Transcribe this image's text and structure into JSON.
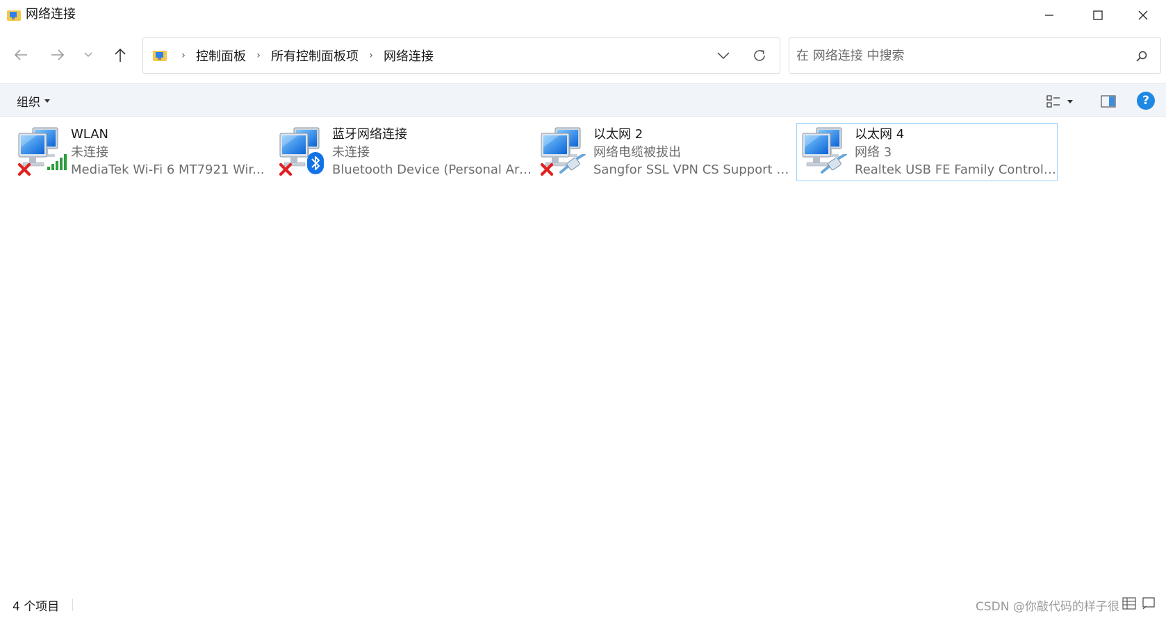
{
  "window": {
    "title": "网络连接",
    "controls": [
      "minimize",
      "maximize",
      "close"
    ]
  },
  "nav": {
    "breadcrumb": [
      "控制面板",
      "所有控制面板项",
      "网络连接"
    ],
    "search_placeholder": "在 网络连接 中搜索"
  },
  "toolbar": {
    "organize_label": "组织",
    "help_label": "?"
  },
  "items": [
    {
      "name": "WLAN",
      "status": "未连接",
      "device": "MediaTek Wi-Fi 6 MT7921 Wir...",
      "icon": "wifi-adapter-icon",
      "disconnected": true
    },
    {
      "name": "蓝牙网络连接",
      "status": "未连接",
      "device": "Bluetooth Device (Personal Are...",
      "icon": "bluetooth-adapter-icon",
      "disconnected": true
    },
    {
      "name": "以太网 2",
      "status": "网络电缆被拔出",
      "device": "Sangfor SSL VPN CS Support S...",
      "icon": "ethernet-adapter-icon",
      "disconnected": true
    },
    {
      "name": "以太网 4",
      "status": "网络 3",
      "device": "Realtek USB FE Family Controll...",
      "icon": "ethernet-adapter-icon",
      "disconnected": false,
      "selected": true
    }
  ],
  "statusbar": {
    "count": "4 个项目",
    "watermark": "CSDN @你敲代码的样子很"
  },
  "colors": {
    "accent": "#1e88e5",
    "selection_border": "#99d1ff",
    "command_bar": "#f1f4f9",
    "error_red": "#e02020"
  }
}
